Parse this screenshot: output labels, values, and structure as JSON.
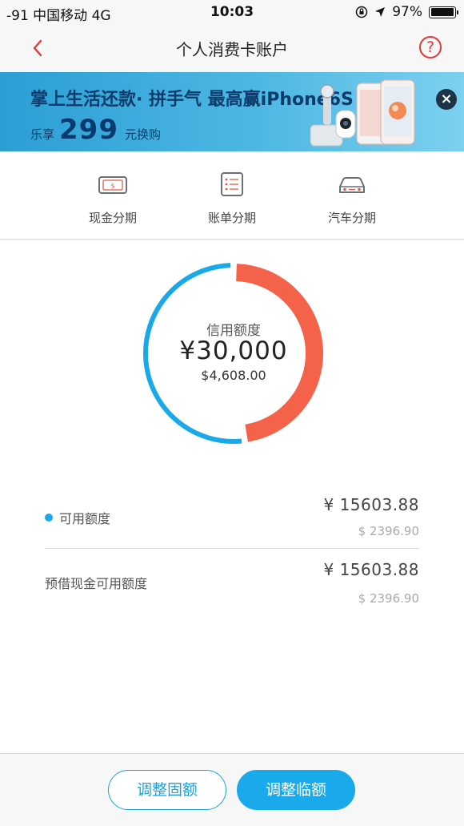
{
  "status_bar": {
    "signal": "-91 中国移动  4G",
    "time": "10:03",
    "battery": "97%",
    "battery_level": 0.97
  },
  "nav": {
    "title": "个人消费卡账户",
    "help": "?"
  },
  "banner": {
    "line1": "掌上生活还款· 拼手气 最高赢iPhone6S",
    "prefix": "乐享",
    "big_number": "299",
    "suffix": "元换购",
    "close": "×"
  },
  "shortcuts": [
    {
      "label": "现金分期",
      "icon": "cash-icon"
    },
    {
      "label": "账单分期",
      "icon": "bill-icon"
    },
    {
      "label": "汽车分期",
      "icon": "car-icon"
    }
  ],
  "credit": {
    "label": "信用额度",
    "amount": "¥30,000",
    "usd": "$4,608.00",
    "available_fraction": 0.52,
    "colors": {
      "available": "#1aa9e8",
      "used": "#f4624a"
    }
  },
  "details": [
    {
      "label": "可用额度",
      "amount": "¥ 15603.88",
      "usd": "$ 2396.90"
    },
    {
      "label": "预借现金可用额度",
      "amount": "¥ 15603.88",
      "usd": "$ 2396.90"
    }
  ],
  "buttons": {
    "fixed": "调整固额",
    "temp": "调整临额"
  }
}
